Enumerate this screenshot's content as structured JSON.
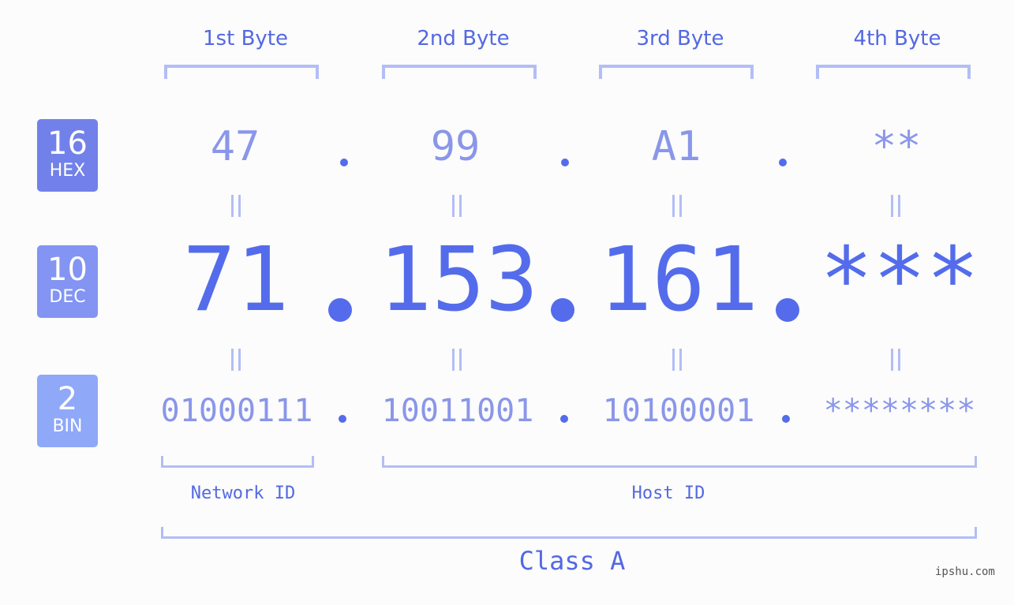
{
  "bases": [
    {
      "number": "16",
      "name": "HEX",
      "color": "#7281ea"
    },
    {
      "number": "10",
      "name": "DEC",
      "color": "#8394f2"
    },
    {
      "number": "2",
      "name": "BIN",
      "color": "#8fa8f8"
    }
  ],
  "byte_labels": [
    "1st Byte",
    "2nd Byte",
    "3rd Byte",
    "4th Byte"
  ],
  "hex": [
    "47",
    "99",
    "A1",
    "**"
  ],
  "dec": [
    "71",
    "153",
    "161",
    "***"
  ],
  "bin": [
    "01000111",
    "10011001",
    "10100001",
    "********"
  ],
  "separator": ".",
  "network_label": "Network ID",
  "host_label": "Host ID",
  "class_label": "Class A",
  "watermark": "ipshu.com",
  "colors": {
    "accent": "#546ceb",
    "light": "#8a96ea",
    "bracket": "#b3bdf6"
  }
}
